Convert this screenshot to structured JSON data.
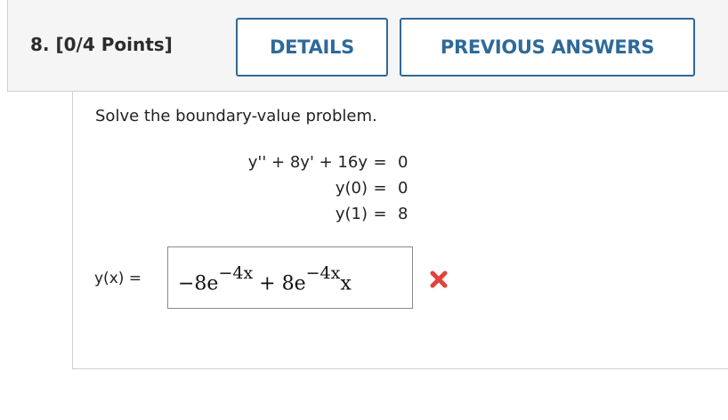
{
  "question": {
    "title": "8. [0/4 Points]",
    "details_label": "DETAILS",
    "previous_answers_label": "PREVIOUS ANSWERS"
  },
  "problem": {
    "prompt": "Solve the boundary-value problem.",
    "equations": [
      {
        "lhs": "y'' + 8y' + 16y",
        "eq": "=",
        "rhs": "0"
      },
      {
        "lhs": "y(0)",
        "eq": "=",
        "rhs": "0"
      },
      {
        "lhs": "y(1)",
        "eq": "=",
        "rhs": "8"
      }
    ]
  },
  "answer": {
    "label": "y(x) =",
    "term1_coef": "−8e",
    "term1_exp": "−4x",
    "plus": " + ",
    "term2_coef": "8e",
    "term2_exp": "−4x",
    "term2_tail": "x",
    "status_icon": "red-x-icon",
    "status_color": "#e0433b"
  }
}
